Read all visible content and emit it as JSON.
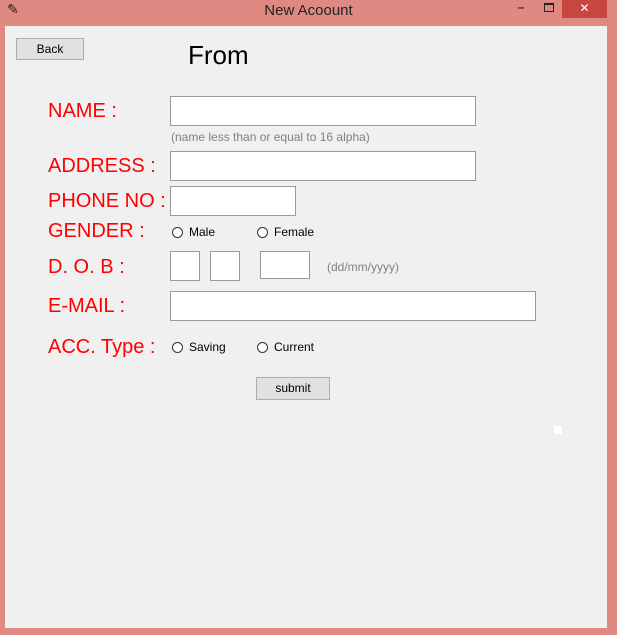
{
  "window": {
    "title": "New Acoount",
    "app_icon": "feather-icon",
    "close_glyph": "✕",
    "minimize_glyph": "–"
  },
  "toolbar": {
    "back_label": "Back"
  },
  "form": {
    "heading": "From",
    "name_label": "NAME :",
    "name_value": "",
    "name_hint": "(name less than or equal to 16 alpha)",
    "address_label": "ADDRESS :",
    "address_value": "",
    "phone_label": "PHONE NO :",
    "phone_value": "",
    "gender_label": "GENDER :",
    "gender_options": [
      "Male",
      "Female"
    ],
    "dob_label": "D. O. B :",
    "dob_day": "",
    "dob_month": "",
    "dob_year": "",
    "dob_hint": "(dd/mm/yyyy)",
    "email_label": "E-MAIL :",
    "email_value": "",
    "acc_type_label": "ACC. Type :",
    "acc_type_options": [
      "Saving",
      "Current"
    ],
    "submit_label": "submit"
  }
}
